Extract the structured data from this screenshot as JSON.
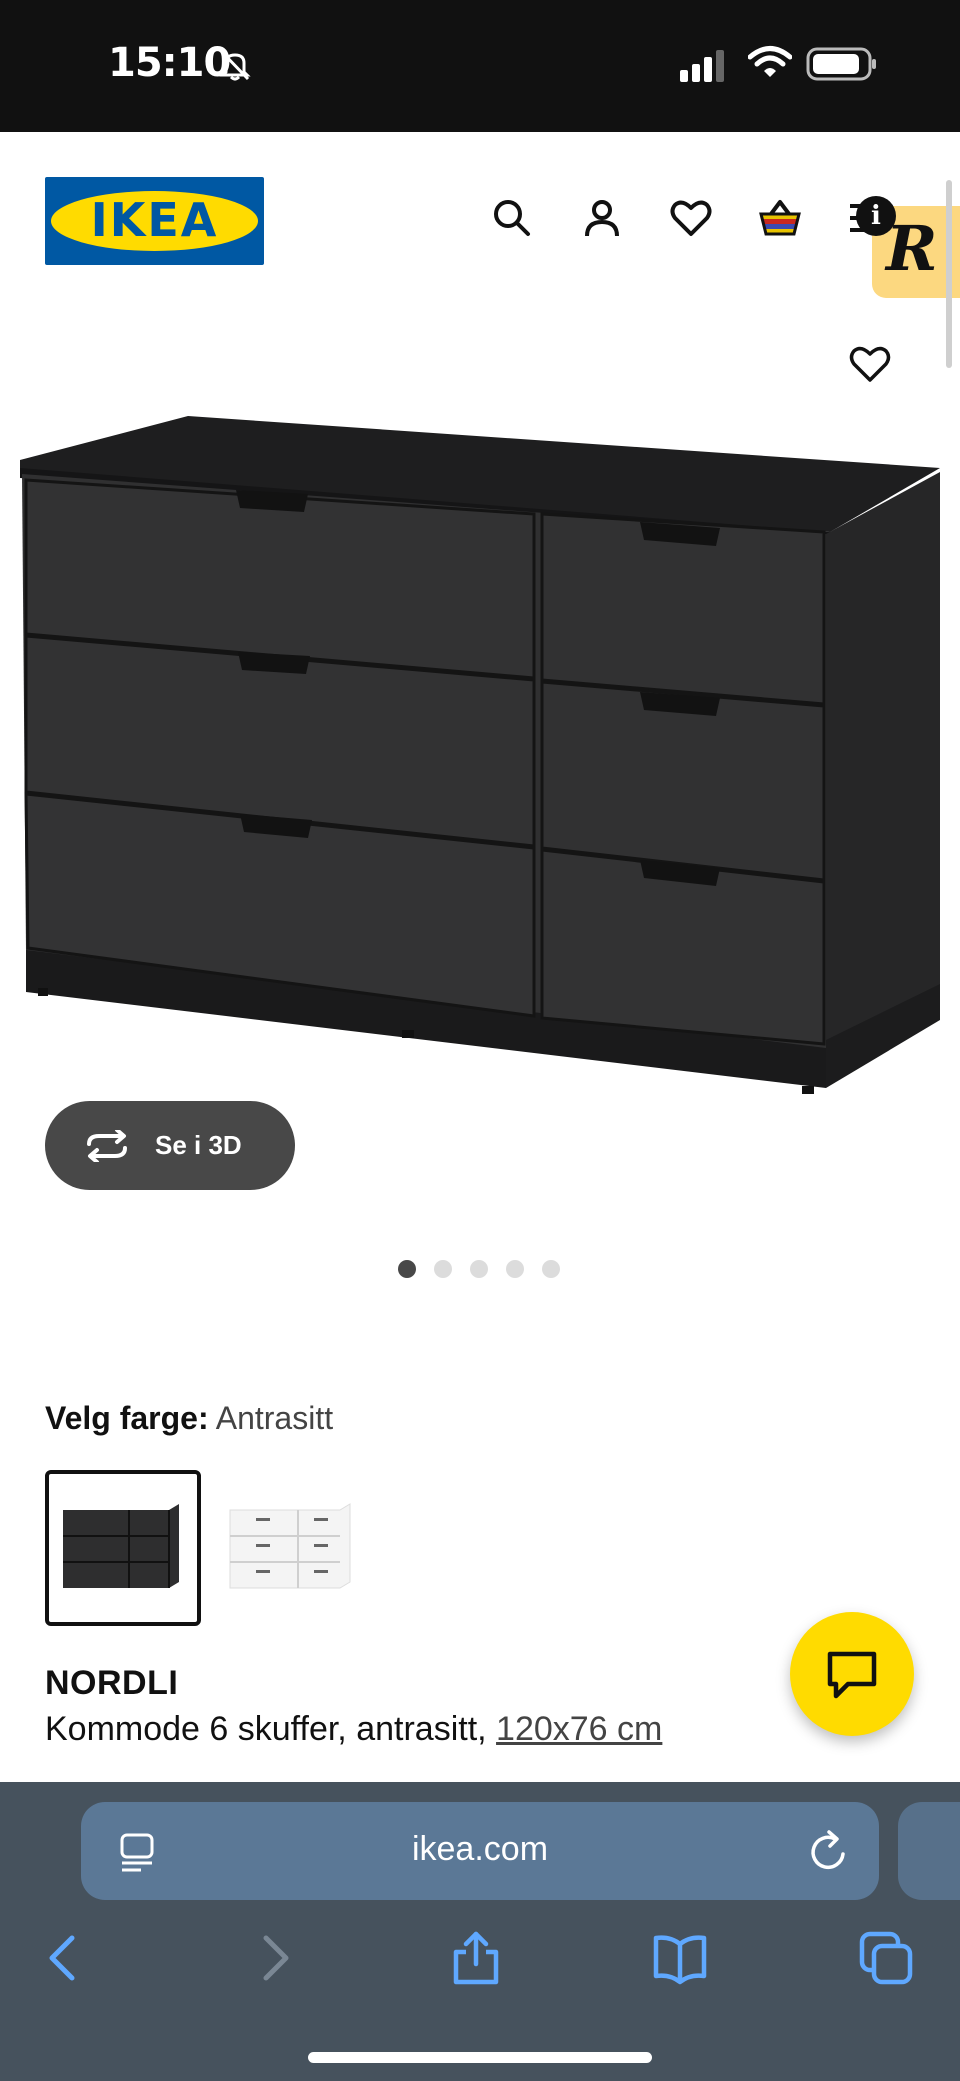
{
  "status_bar": {
    "time": "15:10"
  },
  "header": {
    "logo_text": "IKEA",
    "icons": [
      "search-icon",
      "account-icon",
      "favourites-icon",
      "basket-icon",
      "menu-icon"
    ],
    "info_badge": "i",
    "extension_letter": "R"
  },
  "gallery": {
    "view_3d_label": "Se i 3D",
    "image_count": 5,
    "active_index": 0
  },
  "color_picker": {
    "label": "Velg farge:",
    "selected_value": "Antrasitt",
    "options": [
      "antrasitt",
      "hvit"
    ]
  },
  "product": {
    "name": "NORDLI",
    "description": "Kommode 6 skuffer, antrasitt,",
    "dimensions": "120x76 cm"
  },
  "browser": {
    "url": "ikea.com"
  },
  "colors": {
    "ikea_blue": "#0058a3",
    "ikea_yellow": "#ffdb00",
    "product_dark": "#2f2f30",
    "browser_bar": "#46525d",
    "url_field": "#5b7896"
  }
}
